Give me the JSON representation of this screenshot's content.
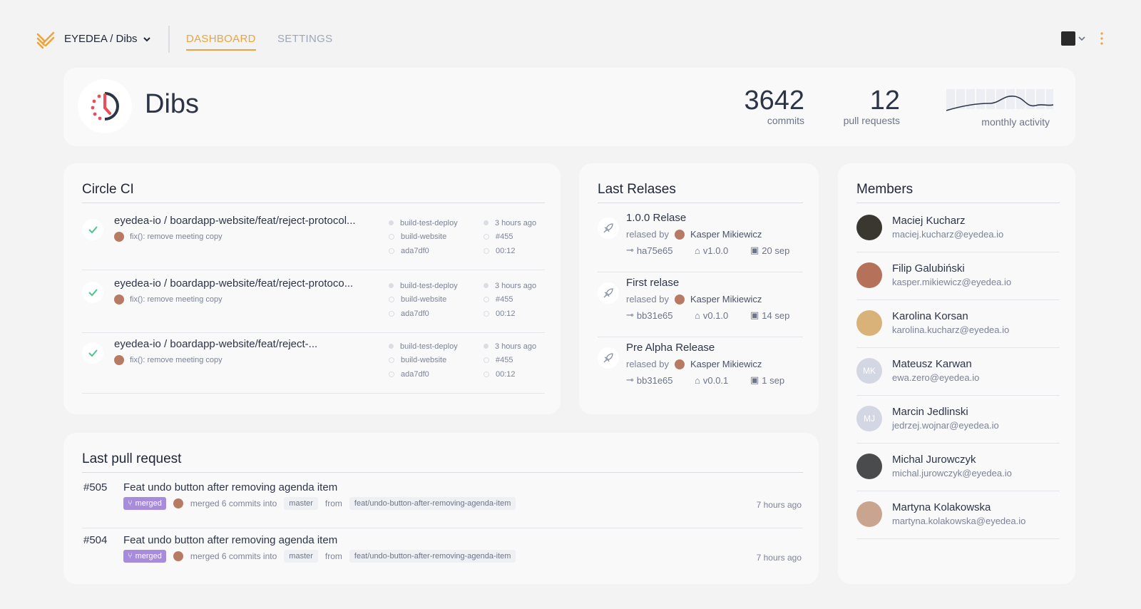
{
  "topbar": {
    "project": "EYEDEA / Dibs",
    "tabs": [
      {
        "label": "DASHBOARD",
        "active": true
      },
      {
        "label": "SETTINGS",
        "active": false
      }
    ],
    "accent": "#e9a53f"
  },
  "hero": {
    "title": "Dibs",
    "commits_value": "3642",
    "commits_label": "commits",
    "prs_value": "12",
    "prs_label": "pull requests",
    "activity_label": "monthly activity"
  },
  "circleci": {
    "title": "Circle CI",
    "builds": [
      {
        "title": "eyedea-io / boardapp-website/feat/reject-protocol...",
        "commit": "fix(): remove meeting copy",
        "jobs": [
          "build-test-deploy",
          "build-website",
          "ada7df0"
        ],
        "time": "3 hours ago",
        "build_no": "#455",
        "duration": "00:12"
      },
      {
        "title": "eyedea-io / boardapp-website/feat/reject-protoco...",
        "commit": "fix(): remove meeting copy",
        "jobs": [
          "build-test-deploy",
          "build-website",
          "ada7df0"
        ],
        "time": "3 hours ago",
        "build_no": "#455",
        "duration": "00:12"
      },
      {
        "title": "eyedea-io / boardapp-website/feat/reject-...",
        "commit": "fix(): remove meeting copy",
        "jobs": [
          "build-test-deploy",
          "build-website",
          "ada7df0"
        ],
        "time": "3 hours ago",
        "build_no": "#455",
        "duration": "00:12"
      }
    ]
  },
  "releases": {
    "title": "Last Relases",
    "items": [
      {
        "name": "1.0.0  Relase",
        "by_label": "relased by",
        "author": "Kasper Mikiewicz",
        "commit": "ha75e65",
        "tag": "v1.0.0",
        "date": "20 sep"
      },
      {
        "name": "First relase",
        "by_label": "relased by",
        "author": "Kasper Mikiewicz",
        "commit": "bb31e65",
        "tag": "v0.1.0",
        "date": "14 sep"
      },
      {
        "name": "Pre Alpha Release",
        "by_label": "relased by",
        "author": "Kasper Mikiewicz",
        "commit": "bb31e65",
        "tag": "v0.0.1",
        "date": "1 sep"
      }
    ]
  },
  "members": {
    "title": "Members",
    "items": [
      {
        "name": "Maciej Kucharz",
        "email": "maciej.kucharz@eyedea.io",
        "initials": "",
        "color": "#3a3630"
      },
      {
        "name": "Filip Galubiński",
        "email": "kasper.mikiewicz@eyedea.io",
        "initials": "",
        "color": "#b5715a"
      },
      {
        "name": "Karolina Korsan",
        "email": "karolina.kucharz@eyedea.io",
        "initials": "",
        "color": "#d9b27a"
      },
      {
        "name": "Mateusz Karwan",
        "email": "ewa.zero@eyedea.io",
        "initials": "MK",
        "color": "#d3d6e3"
      },
      {
        "name": "Marcin Jedlinski",
        "email": "jedrzej.wojnar@eyedea.io",
        "initials": "MJ",
        "color": "#d3d6e3"
      },
      {
        "name": "Michal Jurowczyk",
        "email": "michal.jurowczyk@eyedea.io",
        "initials": "",
        "color": "#4a4b4d"
      },
      {
        "name": "Martyna Kolakowska",
        "email": "martyna.kolakowska@eyedea.io",
        "initials": "",
        "color": "#c9a48e"
      }
    ]
  },
  "pull_requests": {
    "title": "Last pull request",
    "items": [
      {
        "number": "#505",
        "title": "Feat undo button after removing agenda item",
        "badge": "merged",
        "merged_text": "merged 6 commits into",
        "target": "master",
        "from_label": "from",
        "source": "feat/undo-button-after-removing-agenda-item",
        "time": "7 hours ago"
      },
      {
        "number": "#504",
        "title": "Feat undo button after removing agenda item",
        "badge": "merged",
        "merged_text": "merged 6 commits into",
        "target": "master",
        "from_label": "from",
        "source": "feat/undo-button-after-removing-agenda-item",
        "time": "7 hours ago"
      }
    ],
    "badge_color": "#a78bdc"
  }
}
